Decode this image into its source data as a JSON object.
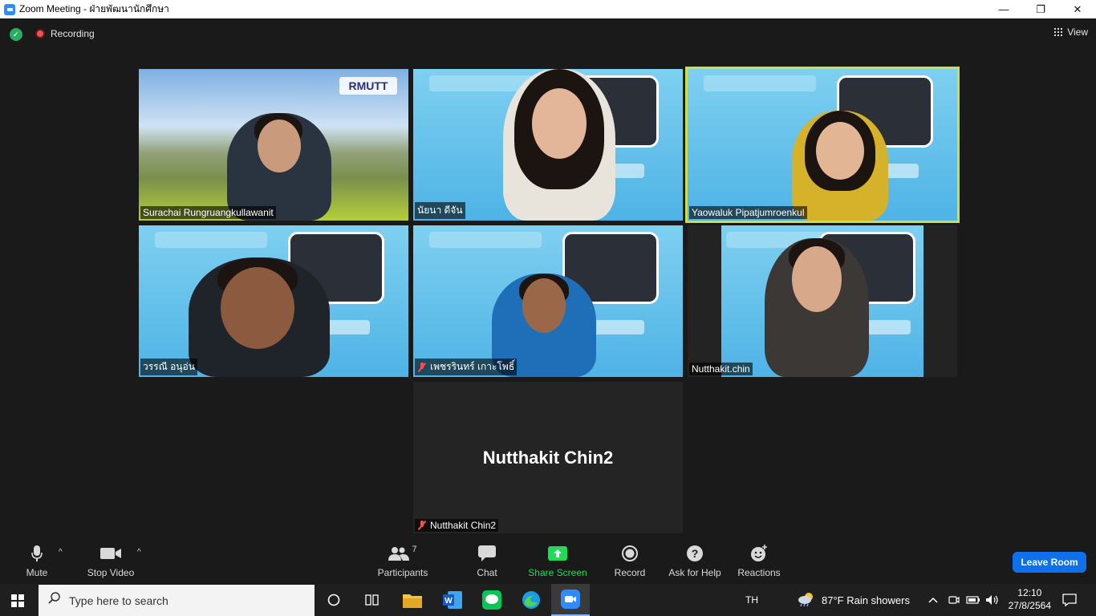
{
  "window": {
    "title": "Zoom Meeting - ฝ่ายพัฒนานักศึกษา",
    "minimize": "—",
    "maximize": "❐",
    "close": "✕"
  },
  "topbar": {
    "recording_label": "Recording",
    "view_label": "View"
  },
  "participants": [
    {
      "name": "Surachai Rungruangkullawanit",
      "muted": false
    },
    {
      "name": "นัยนา  ดีจัน",
      "muted": false
    },
    {
      "name": "Yaowaluk Pipatjumroenkul",
      "muted": false,
      "active_speaker": true
    },
    {
      "name": "วรรณี  อนุอ่น",
      "muted": false
    },
    {
      "name": "เพชรรินทร์ เกาะโพธิ์",
      "muted": true
    },
    {
      "name": "Nutthakit.chin",
      "muted": false
    },
    {
      "name": "Nutthakit Chin2",
      "muted": true,
      "video_off": true
    }
  ],
  "placeholder": {
    "display_name": "Nutthakit Chin2"
  },
  "logo_text": "RMUTT",
  "toolbar": {
    "mute": "Mute",
    "stop_video": "Stop Video",
    "participants": "Participants",
    "participants_count": "7",
    "chat": "Chat",
    "share_screen": "Share Screen",
    "record": "Record",
    "ask_for_help": "Ask for Help",
    "reactions": "Reactions",
    "leave_room": "Leave Room"
  },
  "taskbar": {
    "search_placeholder": "Type here to search",
    "language": "TH",
    "weather": "87°F  Rain showers",
    "time": "12:10",
    "date": "27/8/2564"
  },
  "colors": {
    "accent": "#0e71eb",
    "share_green": "#23d959",
    "active_border": "#c8e04a",
    "muted_red": "#ff4d4d"
  }
}
